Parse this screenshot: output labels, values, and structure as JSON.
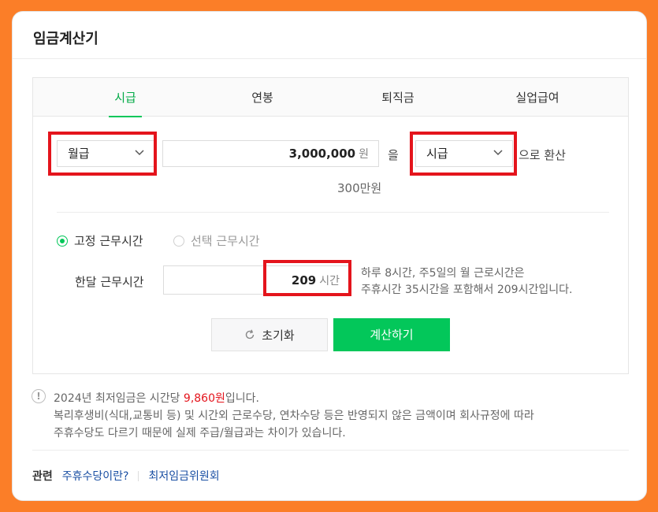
{
  "title": "임금계산기",
  "tabs": [
    {
      "label": "시급",
      "active": true
    },
    {
      "label": "연봉",
      "active": false
    },
    {
      "label": "퇴직금",
      "active": false
    },
    {
      "label": "실업급여",
      "active": false
    }
  ],
  "converter": {
    "from_select": "월급",
    "amount": "3,000,000",
    "amount_unit": "원",
    "particle": "을",
    "to_select": "시급",
    "suffix": "으로 환산",
    "amount_hint": "300만원"
  },
  "work_time": {
    "option_fixed": "고정 근무시간",
    "option_flexible": "선택 근무시간",
    "selected": "fixed",
    "monthly_label": "한달 근무시간",
    "hours": "209",
    "hours_unit": "시간",
    "description_line1": "하루 8시간, 주5일의 월 근로시간은",
    "description_line2": "주휴시간 35시간을 포함해서 209시간입니다."
  },
  "buttons": {
    "reset": "초기화",
    "calculate": "계산하기"
  },
  "notice": {
    "line1_prefix": "2024년 최저임금은 시간당 ",
    "line1_wage": "9,860원",
    "line1_suffix": "입니다.",
    "line2": "복리후생비(식대,교통비 등) 및 시간외 근로수당, 연차수당 등은 반영되지 않은 금액이며 회사규정에 따라",
    "line3": "주휴수당도 다르기 때문에 실제 주급/월급과는 차이가 있습니다."
  },
  "related": {
    "label": "관련",
    "links": [
      "주휴수당이란?",
      "최저임금위원회"
    ]
  },
  "colors": {
    "accent": "#03c75a",
    "highlight": "#e4141c",
    "background": "#fb7e28"
  },
  "icons": {
    "select_arrow": "chevron-down-icon",
    "reset": "refresh-icon",
    "notice": "exclamation-circle-icon"
  }
}
